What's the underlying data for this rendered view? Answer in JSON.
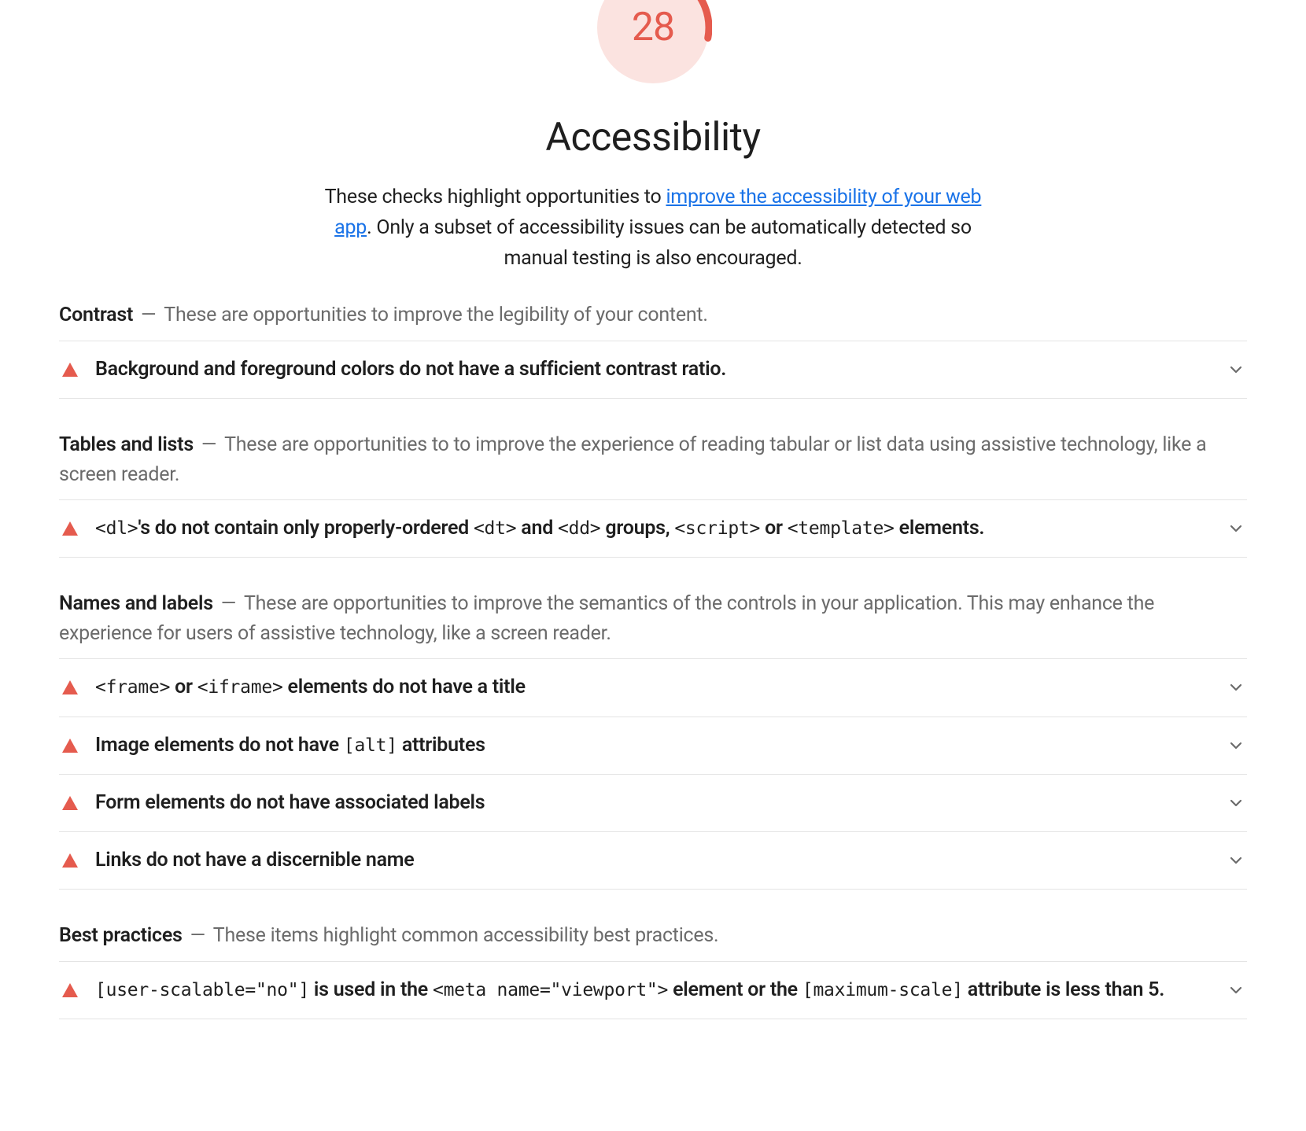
{
  "score": {
    "value": "28",
    "percent": 28,
    "color": "#E55B4E",
    "bg_color": "#FBE3E0"
  },
  "title": "Accessibility",
  "subhead": {
    "prefix": "These checks highlight opportunities to ",
    "link_text": "improve the accessibility of your web app",
    "suffix": ". Only a subset of accessibility issues can be automatically detected so manual testing is also encouraged."
  },
  "groups": [
    {
      "title": "Contrast",
      "desc": "These are opportunities to improve the legibility of your content.",
      "audits": [
        {
          "text": "Background and foreground colors do not have a sufficient contrast ratio."
        }
      ]
    },
    {
      "title": "Tables and lists",
      "desc": "These are opportunities to to improve the experience of reading tabular or list data using assistive technology, like a screen reader.",
      "audits": [
        {
          "html": "<code>&lt;dl&gt;</code>'s do not contain only properly-ordered <code>&lt;dt&gt;</code> and <code>&lt;dd&gt;</code> groups, <code>&lt;script&gt;</code> or <code>&lt;template&gt;</code> elements."
        }
      ]
    },
    {
      "title": "Names and labels",
      "desc": "These are opportunities to improve the semantics of the controls in your application. This may enhance the experience for users of assistive technology, like a screen reader.",
      "audits": [
        {
          "html": "<code>&lt;frame&gt;</code> or <code>&lt;iframe&gt;</code> elements do not have a title"
        },
        {
          "html": "Image elements do not have <code>[alt]</code> attributes"
        },
        {
          "text": "Form elements do not have associated labels"
        },
        {
          "text": "Links do not have a discernible name"
        }
      ]
    },
    {
      "title": "Best practices",
      "desc": "These items highlight common accessibility best practices.",
      "audits": [
        {
          "html": "<code>[user-scalable=\"no\"]</code> is used in the <code>&lt;meta name=\"viewport\"&gt;</code> element or the <code>[maximum-scale]</code> attribute is less than 5."
        }
      ]
    }
  ]
}
